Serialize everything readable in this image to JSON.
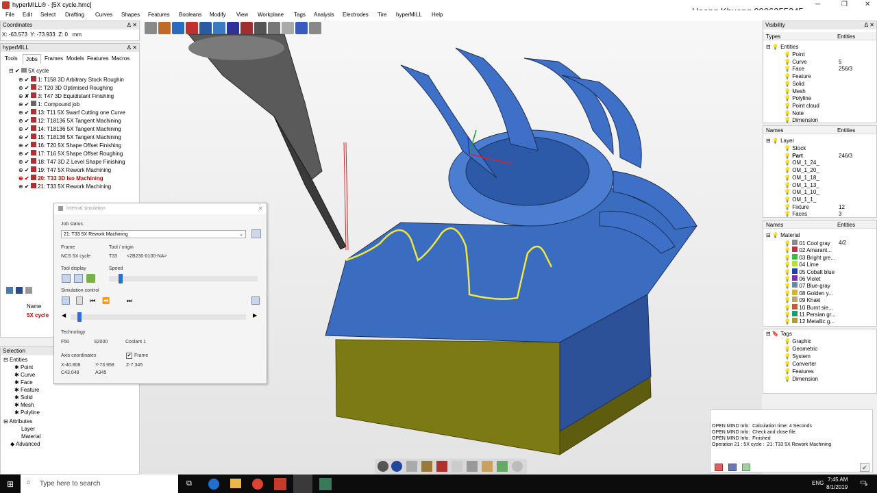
{
  "window": {
    "title": "hyperMILL® - [5X cycle.hmc]",
    "controls": [
      "─",
      "❐",
      "✕"
    ]
  },
  "watermark": "Hoang Khuong 0906355245",
  "menu": [
    "File",
    "Edit",
    "Select",
    "Drafting",
    "Curves",
    "Shapes",
    "Features",
    "Booleans",
    "Modify",
    "View",
    "Workplane",
    "Tags",
    "Analysis",
    "Electrodes",
    "Tire",
    "hyperMILL",
    "Help"
  ],
  "coordinates": {
    "title": "Coordinates",
    "x_label": "X:",
    "x": "-63.573",
    "y_label": "Y:",
    "y": "-73.933",
    "z_label": "Z:",
    "z": "0",
    "unit": "mm"
  },
  "hypermill_panel": {
    "title": "hyperMILL",
    "tabs": [
      "Tools",
      "Jobs",
      "Frames",
      "Models",
      "Features",
      "Macros"
    ],
    "root": "5X cycle",
    "jobs": [
      "1: T158 3D Arbitrary Stock Roughin",
      "2: T20 3D Optimised Roughing",
      "3: T47 3D Equidistant Finishing",
      "1: Compound job",
      "13: T11 5X Swarf Cutting one Curve",
      "12: T18136 5X Tangent Machining",
      "14: T18136 5X Tangent Machining",
      "15: T18136 5X Tangent Machining",
      "16: T20 5X Shape Offset Finishing",
      "17: T16 5X Shape Offset Roughing",
      "18: T47 3D Z Level Shape Finishing",
      "19: T47 5X Rework Machining",
      "20: T33 3D Iso Machining",
      "21: T33 5X Rework Machining"
    ],
    "name_header": "Name",
    "name_value": "5X cycle"
  },
  "selection": {
    "title": "Selection",
    "entities": "Entities",
    "items": [
      "Point",
      "Curve",
      "Face",
      "Feature",
      "Solid",
      "Mesh",
      "Polyline"
    ],
    "attributes": "Attributes",
    "attr_items": [
      "Layer",
      "Material"
    ],
    "advanced": "Advanced"
  },
  "sim": {
    "title": "Internal simulation",
    "job_status_label": "Job status",
    "job_status": "21: T33 5X Rework Machining",
    "frame_label": "Frame",
    "frame": "NCS 5X cycle",
    "tool_label": "Tool / origin",
    "tool": "T33",
    "tool_origin": "<2B230-0100-NA>",
    "tool_display_label": "Tool display",
    "speed_label": "Speed",
    "sim_control_label": "Simulation control",
    "technology_label": "Technology",
    "feed": "F50",
    "spindle": "S2000",
    "coolant": "Coolant  1",
    "axis_label": "Axis coordinates",
    "frame_check": "Frame",
    "ax_x": "X-40.808",
    "ax_y": "Y-73.958",
    "ax_z": "Z-7.345",
    "ax_c": "C43.048",
    "ax_a": "A345"
  },
  "visibility": {
    "title": "Visibility",
    "col_types": "Types",
    "col_entities": "Entities",
    "root": "Entities",
    "rows": [
      {
        "name": "Point",
        "count": ""
      },
      {
        "name": "Curve",
        "count": "5"
      },
      {
        "name": "Face",
        "count": "256/3"
      },
      {
        "name": "Feature",
        "count": ""
      },
      {
        "name": "Solid",
        "count": ""
      },
      {
        "name": "Mesh",
        "count": ""
      },
      {
        "name": "Polyline",
        "count": ""
      },
      {
        "name": "Point cloud",
        "count": ""
      },
      {
        "name": "Note",
        "count": ""
      },
      {
        "name": "Dimension",
        "count": ""
      }
    ]
  },
  "layers": {
    "col_names": "Names",
    "col_entities": "Entities",
    "root": "Layer",
    "rows": [
      {
        "name": "Stock",
        "count": ""
      },
      {
        "name": "Part",
        "count": "246/3"
      },
      {
        "name": "OM_1_24_",
        "count": ""
      },
      {
        "name": "OM_1_20_",
        "count": ""
      },
      {
        "name": "OM_1_18_",
        "count": ""
      },
      {
        "name": "OM_1_13_",
        "count": ""
      },
      {
        "name": "OM_1_10_",
        "count": ""
      },
      {
        "name": "OM_1_1_",
        "count": ""
      },
      {
        "name": "Fixture",
        "count": "12"
      },
      {
        "name": "Faces",
        "count": "3"
      }
    ]
  },
  "materials": {
    "col_names": "Names",
    "col_entities": "Entities",
    "root": "Material",
    "rows": [
      {
        "name": "01 Cool gray",
        "count": "4/2",
        "color": "#8a8a8a"
      },
      {
        "name": "02 Amarant...",
        "count": "",
        "color": "#c0304a"
      },
      {
        "name": "03 Bright gre...",
        "count": "",
        "color": "#2fbf3a"
      },
      {
        "name": "04 Lime",
        "count": "",
        "color": "#b8e02a"
      },
      {
        "name": "05 Cobalt blue",
        "count": "",
        "color": "#1d3fb0"
      },
      {
        "name": "06 Violet",
        "count": "",
        "color": "#7a2fb0"
      },
      {
        "name": "07 Blue-gray",
        "count": "",
        "color": "#6a8aa8"
      },
      {
        "name": "08 Golden y...",
        "count": "",
        "color": "#d8b030"
      },
      {
        "name": "09 Khaki",
        "count": "",
        "color": "#b8a870"
      },
      {
        "name": "10 Burnt sie...",
        "count": "",
        "color": "#c85a30"
      },
      {
        "name": "11 Persian gr...",
        "count": "",
        "color": "#1a9a70"
      },
      {
        "name": "12 Metallic g...",
        "count": "",
        "color": "#b09a40"
      }
    ]
  },
  "tags": {
    "root": "Tags",
    "rows": [
      "Graphic",
      "Geometric",
      "System",
      "Converter",
      "Features",
      "Dimension"
    ]
  },
  "log": {
    "lines": [
      {
        "src": "OPEN MIND Info:",
        "msg": "Calculation time: 4 Seconds"
      },
      {
        "src": "OPEN MIND Info:",
        "msg": "Check and close file."
      },
      {
        "src": "OPEN MIND Info:",
        "msg": "Finished"
      },
      {
        "src": "Operation 21 : 5X cycle :",
        "msg": "21: T33 5X Rework Machining"
      }
    ]
  },
  "taskbar": {
    "search": "Type here to search",
    "lang": "ENG",
    "time": "7:45 AM",
    "date": "8/1/2019",
    "notif": "9"
  },
  "colors": {
    "part_blue": "#3a6cc0",
    "stock_olive": "#7b7a14",
    "highlight": "#f2e83a"
  }
}
